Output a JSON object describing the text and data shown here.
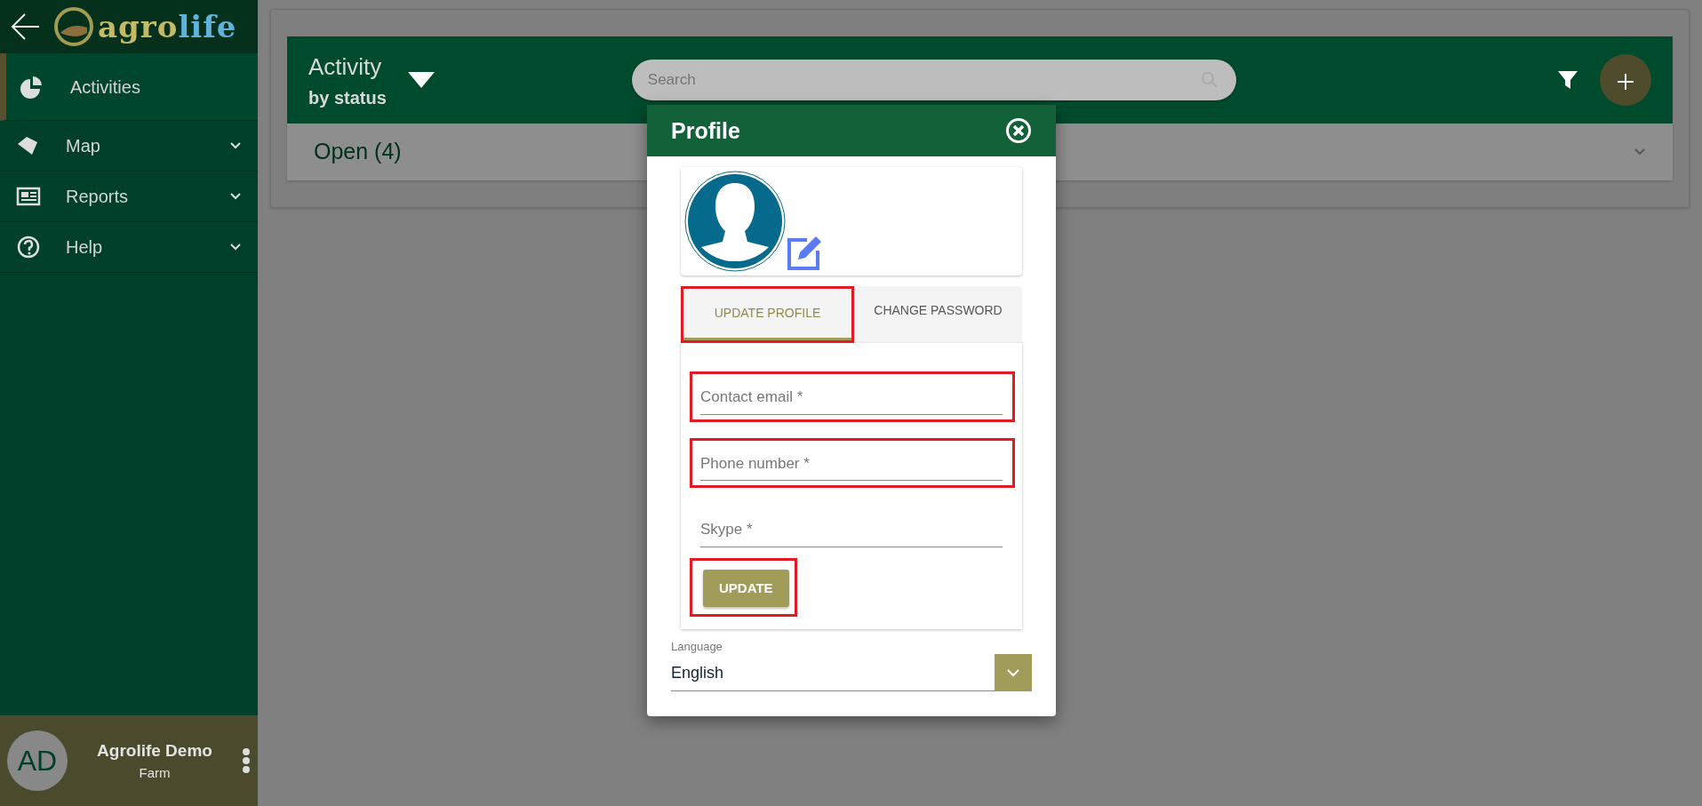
{
  "logo": {
    "part_1": "agro",
    "part_2": "life"
  },
  "sidebar": {
    "items": [
      {
        "kind": "pie",
        "label": "Activities",
        "selected": true,
        "expandable": false
      },
      {
        "kind": "map",
        "label": "Map",
        "selected": false,
        "expandable": true
      },
      {
        "kind": "reports",
        "label": "Reports",
        "selected": false,
        "expandable": true
      },
      {
        "kind": "help",
        "label": "Help",
        "selected": false,
        "expandable": true
      }
    ]
  },
  "user": {
    "initials": "AD",
    "name": "Agrolife Demo",
    "role": "Farm"
  },
  "header": {
    "title": "Activity",
    "subtitle": "by status",
    "search": {
      "placeholder": "Search"
    }
  },
  "groups": [
    {
      "label": "Open (4)",
      "expanded": false
    }
  ],
  "modal": {
    "title": "Profile",
    "tabs": [
      {
        "label": "UPDATE PROFILE",
        "selected": true,
        "highlighted": true
      },
      {
        "label": "CHANGE PASSWORD",
        "selected": false,
        "highlighted": false
      }
    ],
    "fields": [
      {
        "placeholder": "Contact email *",
        "highlighted": true
      },
      {
        "placeholder": "Phone number *",
        "highlighted": true
      },
      {
        "placeholder": "Skype *",
        "highlighted": false
      }
    ],
    "button": {
      "label": "UPDATE",
      "highlighted": true
    },
    "language": {
      "label": "Language",
      "value": "English"
    }
  }
}
